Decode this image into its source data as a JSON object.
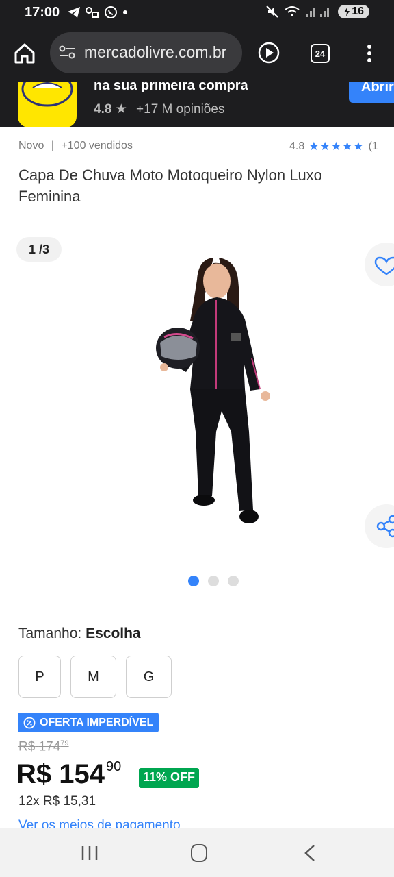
{
  "status_bar": {
    "time": "17:00",
    "battery": "16"
  },
  "browser": {
    "url": "mercadolivre.com.br",
    "tab_count": "24"
  },
  "promo": {
    "title": "na sua primeira compra",
    "rating": "4.8",
    "reviews": "+17 M opiniões",
    "button": "Abrir"
  },
  "product": {
    "condition": "Novo",
    "separator": "|",
    "sold": "+100 vendidos",
    "rating": "4.8",
    "stars": "★★★★★",
    "review_count": "(1",
    "title": "Capa De Chuva Moto Motoqueiro Nylon Luxo Feminina"
  },
  "gallery": {
    "counter": "1 /3"
  },
  "variants": {
    "label": "Tamanho:",
    "selected": "Escolha",
    "sizes": [
      "P",
      "M",
      "G"
    ]
  },
  "pricing": {
    "offer_badge": "OFERTA IMPERDÍVEL",
    "currency": "R$",
    "old_price_int": "174",
    "old_price_cents": "79",
    "price_int": "154",
    "price_cents": "90",
    "discount": "11% OFF",
    "installments": "12x R$ 15,31",
    "payment_link": "Ver os meios de pagamento"
  },
  "colors": {
    "brand_yellow": "#ffe600",
    "accent_blue": "#3483fa",
    "discount_green": "#00a650",
    "dark_bar": "#1d1d1f"
  }
}
